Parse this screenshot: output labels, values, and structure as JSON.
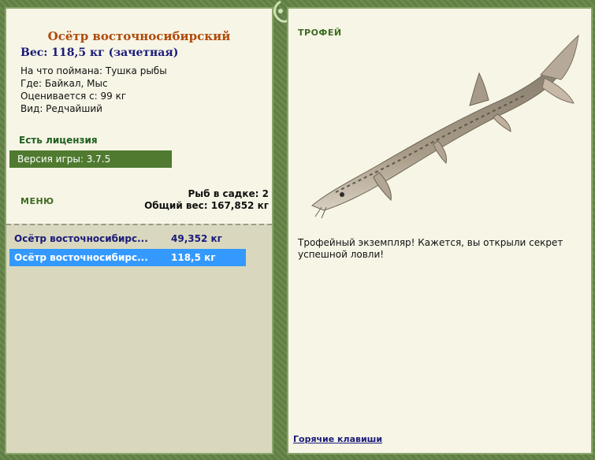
{
  "fish": {
    "name": "Осётр восточносибирский",
    "weight": "Вес: 118,5 кг (зачетная)",
    "caught_on": "На что поймана: Тушка рыбы",
    "where": "Где: Байкал, Мыс",
    "value": "Оценивается с: 99 кг",
    "kind": "Вид: Редчайший"
  },
  "license": "Есть лицензия",
  "version": "Версия игры: 3.7.5",
  "menu_label": "МЕНЮ",
  "keepnet": {
    "count_text": "Рыб в садке: 2",
    "total_text": "Общий вес: 167,852 кг",
    "rows": [
      {
        "name": "Осётр восточносибирс...",
        "weight": "49,352 кг"
      },
      {
        "name": "Осётр восточносибирс...",
        "weight": "118,5 кг"
      }
    ]
  },
  "right": {
    "trophy_label": "ТРОФЕЙ",
    "description": "Трофейный экземпляр! Кажется, вы открыли секрет успешной ловли!",
    "hotkeys": "Горячие клавиши"
  },
  "colors": {
    "frame": "#6b8a4e",
    "panel": "#f6f5e6",
    "selected_row": "#3399ff",
    "version_bar": "#4f7a30"
  },
  "icons": {
    "ornament": "vine-ornament-icon",
    "fish": "sturgeon-image"
  }
}
